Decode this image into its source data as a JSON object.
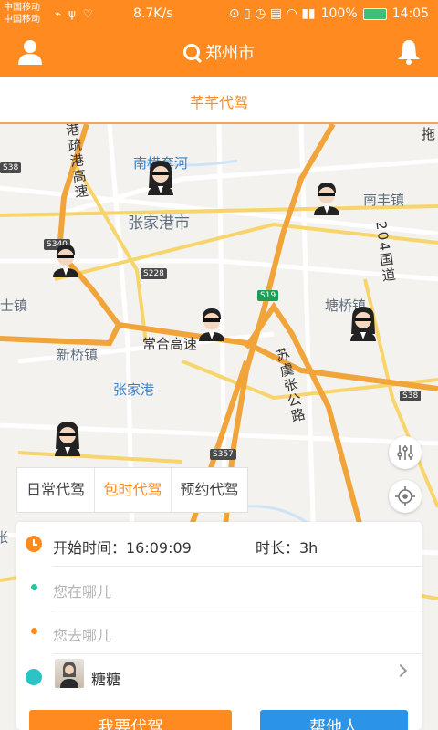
{
  "status_bar": {
    "carrier_1": "中国移动",
    "carrier_2": "中国移动",
    "speed": "8.7K/s",
    "battery": "100%",
    "time": "14:05"
  },
  "header": {
    "city": "郑州市"
  },
  "topbar": {
    "title": "芊芊代驾"
  },
  "map": {
    "labels": {
      "nanhengtaohe": "南横套河",
      "zhangjiagangshi": "张家港市",
      "nanfengzhen": "南丰镇",
      "tangqiaozhen": "塘桥镇",
      "shizhen": "士镇",
      "xinqiaozhen": "新桥镇",
      "changhegaosu": "常合高速",
      "zhangjiagang": "张家港",
      "suyuzhanggonglu": "苏虞张公路",
      "gangshugangaosu": "港疏港高速",
      "road_204": "204国道",
      "left_edge": "张",
      "top_edge": "拖"
    },
    "badges": {
      "s38_left": "S38",
      "s340": "S340",
      "s228": "S228",
      "s19": "S19",
      "s38_right": "S38",
      "s357": "S357"
    }
  },
  "service_tabs": [
    {
      "label": "日常代驾"
    },
    {
      "label": "包时代驾"
    },
    {
      "label": "预约代驾"
    }
  ],
  "booking": {
    "start_label": "开始时间：16:09:09",
    "duration_label": "时长：3h",
    "from_placeholder": "您在哪儿",
    "to_placeholder": "您去哪儿",
    "contact_name": "糖糖",
    "call_button": "我要代驾",
    "help_button": "帮他人"
  },
  "colors": {
    "brand": "#ff8a1f",
    "secondary": "#2b93e8",
    "from_dot": "#2cc3a0",
    "to_dot": "#ff8a1f"
  }
}
